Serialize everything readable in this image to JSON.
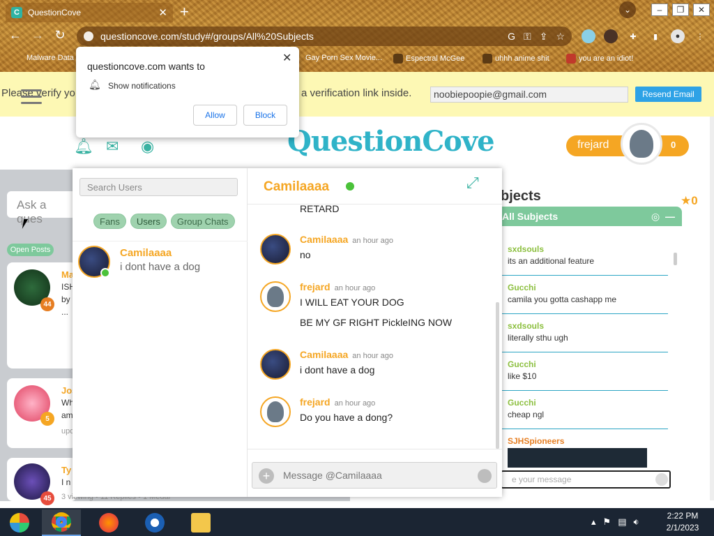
{
  "browser": {
    "tab_title": "QuestionCove",
    "url": "questioncove.com/study#/groups/All%20Subjects",
    "bookmarks": [
      "Malware Data",
      "Gay Porn Sex Movie...",
      "Espectral McGee",
      "uhhh anime shit",
      "you are an idiot!"
    ]
  },
  "notification": {
    "title": "questioncove.com wants to",
    "permission": "Show notifications",
    "allow_label": "Allow",
    "block_label": "Block"
  },
  "verify": {
    "text_left": "Please verify yo",
    "text_right": "a verification link inside.",
    "email": "noobiepoopie@gmail.com",
    "resend_label": "Resend Email"
  },
  "header": {
    "logo": "QuestionCove",
    "username": "frejard",
    "medal_count": "0"
  },
  "feed": {
    "ask_placeholder": "Ask a ques",
    "open_posts_label": "Open Posts",
    "posts": [
      {
        "name": "Ma",
        "badge": "44",
        "lines": [
          "ISH",
          "by",
          "..."
        ]
      },
      {
        "name": "Jos",
        "badge": "5",
        "lines": [
          "Wh",
          "am",
          "upd"
        ]
      },
      {
        "name": "Ty",
        "badge": "45",
        "lines": [
          "I n",
          "3 viewing • 11 Replies • 1 Medal"
        ]
      }
    ]
  },
  "messenger": {
    "search_placeholder": "Search Users",
    "filters": [
      "Fans",
      "Users",
      "Group Chats"
    ],
    "contact": {
      "name": "Camilaaaa",
      "last_message": "i dont have a dog"
    },
    "chat_title": "Camilaaaa",
    "input_placeholder": "Message @Camilaaaa",
    "messages": [
      {
        "author": "",
        "time": "",
        "lines": [
          "RETARD"
        ]
      },
      {
        "author": "Camilaaaa",
        "time": "an hour ago",
        "lines": [
          "no"
        ]
      },
      {
        "author": "frejard",
        "time": "an hour ago",
        "lines": [
          "I WILL EAT YOUR DOG",
          "BE MY GF RIGHT PickleING NOW"
        ]
      },
      {
        "author": "Camilaaaa",
        "time": "an hour ago",
        "lines": [
          "i dont have a dog"
        ]
      },
      {
        "author": "frejard",
        "time": "an hour ago",
        "lines": [
          "Do you have a dong?"
        ]
      }
    ]
  },
  "group_chat": {
    "section_title": "bjects",
    "medal_count": "0",
    "room_title": "All Subjects",
    "messages": [
      {
        "user": "sxdsouls",
        "text": "its an additional feature"
      },
      {
        "user": "Gucchi",
        "text": "camila you gotta cashapp me"
      },
      {
        "user": "sxdsouls",
        "text": "literally sthu ugh"
      },
      {
        "user": "Gucchi",
        "text": "like $10"
      },
      {
        "user": "Gucchi",
        "text": "cheap ngl"
      },
      {
        "user": "SJHSpioneers",
        "text": ""
      }
    ],
    "input_placeholder": "e your message"
  },
  "taskbar": {
    "time": "2:22 PM",
    "date": "2/1/2023"
  },
  "colors": {
    "accent_orange": "#f5a623",
    "accent_teal": "#2fb3a3",
    "pill_green": "#7ec99c",
    "online_green": "#4bc23a"
  }
}
